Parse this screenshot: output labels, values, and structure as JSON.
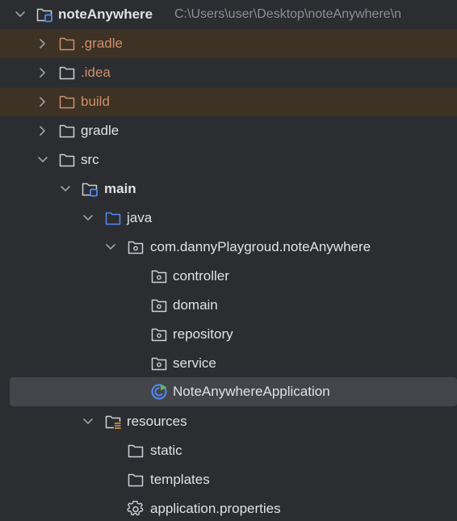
{
  "project": {
    "name": "noteAnywhere",
    "path": "C:\\Users\\user\\Desktop\\noteAnywhere\\n"
  },
  "nodes": {
    "gradle_hidden": ".gradle",
    "idea": ".idea",
    "build": "build",
    "gradle": "gradle",
    "src": "src",
    "main": "main",
    "java": "java",
    "package": "com.dannyPlaygroud.noteAnywhere",
    "controller": "controller",
    "domain": "domain",
    "repository": "repository",
    "service": "service",
    "app_class": "NoteAnywhereApplication",
    "resources": "resources",
    "static": "static",
    "templates": "templates",
    "properties": "application.properties"
  },
  "icons": {
    "chevron_down": "chevron-down-icon",
    "chevron_right": "chevron-right-icon",
    "folder": "folder-icon",
    "module_folder": "module-folder-icon",
    "package": "package-icon",
    "resources_folder": "resources-folder-icon",
    "spring_class": "spring-boot-class-icon",
    "gear": "gear-icon"
  },
  "colors": {
    "background": "#2b2d30",
    "excluded_row": "#3d3223",
    "selected_row": "#43454a",
    "excluded_text": "#cf8e6d",
    "accent_blue": "#548af7",
    "spring_green": "#5fb865"
  }
}
